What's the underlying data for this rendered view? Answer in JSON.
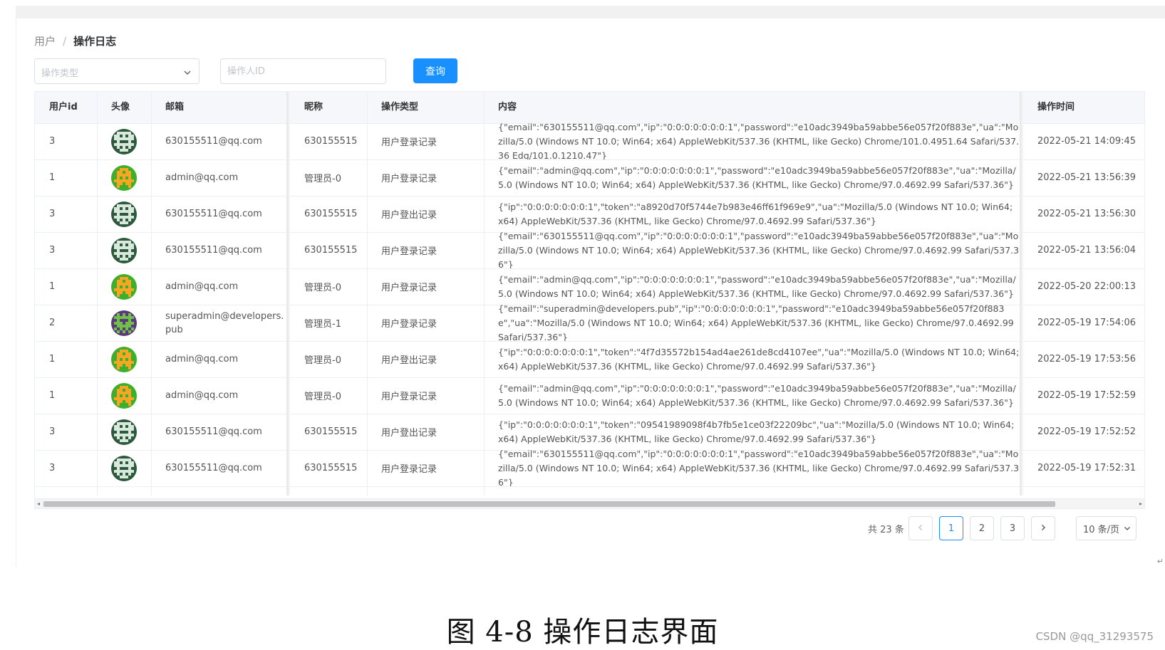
{
  "breadcrumb": {
    "parent": "用户",
    "separator": "/",
    "current": "操作日志"
  },
  "filters": {
    "type_placeholder": "操作类型",
    "operator_placeholder": "操作人ID",
    "query_label": "查询"
  },
  "table": {
    "headers": {
      "user_id": "用户id",
      "avatar": "头像",
      "email": "邮箱",
      "nickname": "昵称",
      "op_type": "操作类型",
      "content": "内容",
      "time": "操作时间"
    },
    "rows": [
      {
        "user_id": "3",
        "avatar": "dark-green-avatar",
        "email": "630155511@qq.com",
        "nickname": "630155515",
        "op_type": "用户登录记录",
        "content": "{\"email\":\"630155511@qq.com\",\"ip\":\"0:0:0:0:0:0:0:1\",\"password\":\"e10adc3949ba59abbe56e057f20f883e\",\"ua\":\"Mozilla/5.0 (Windows NT 10.0; Win64; x64) AppleWebKit/537.36 (KHTML, like Gecko) Chrome/101.0.4951.64 Safari/537.36 Edg/101.0.1210.47\"}",
        "time": "2022-05-21 14:09:45"
      },
      {
        "user_id": "1",
        "avatar": "green-orange-avatar",
        "email": "admin@qq.com",
        "nickname": "管理员-0",
        "op_type": "用户登录记录",
        "content": "{\"email\":\"admin@qq.com\",\"ip\":\"0:0:0:0:0:0:0:1\",\"password\":\"e10adc3949ba59abbe56e057f20f883e\",\"ua\":\"Mozilla/5.0 (Windows NT 10.0; Win64; x64) AppleWebKit/537.36 (KHTML, like Gecko) Chrome/97.0.4692.99 Safari/537.36\"}",
        "time": "2022-05-21 13:56:39"
      },
      {
        "user_id": "3",
        "avatar": "dark-green-avatar",
        "email": "630155511@qq.com",
        "nickname": "630155515",
        "op_type": "用户登出记录",
        "content": "{\"ip\":\"0:0:0:0:0:0:0:1\",\"token\":\"a8920d70f5744e7b983e46ff61f969e9\",\"ua\":\"Mozilla/5.0 (Windows NT 10.0; Win64; x64) AppleWebKit/537.36 (KHTML, like Gecko) Chrome/97.0.4692.99 Safari/537.36\"}",
        "time": "2022-05-21 13:56:30"
      },
      {
        "user_id": "3",
        "avatar": "dark-green-avatar",
        "email": "630155511@qq.com",
        "nickname": "630155515",
        "op_type": "用户登录记录",
        "content": "{\"email\":\"630155511@qq.com\",\"ip\":\"0:0:0:0:0:0:0:1\",\"password\":\"e10adc3949ba59abbe56e057f20f883e\",\"ua\":\"Mozilla/5.0 (Windows NT 10.0; Win64; x64) AppleWebKit/537.36 (KHTML, like Gecko) Chrome/97.0.4692.99 Safari/537.36\"}",
        "time": "2022-05-21 13:56:04"
      },
      {
        "user_id": "1",
        "avatar": "green-orange-avatar",
        "email": "admin@qq.com",
        "nickname": "管理员-0",
        "op_type": "用户登录记录",
        "content": "{\"email\":\"admin@qq.com\",\"ip\":\"0:0:0:0:0:0:0:1\",\"password\":\"e10adc3949ba59abbe56e057f20f883e\",\"ua\":\"Mozilla/5.0 (Windows NT 10.0; Win64; x64) AppleWebKit/537.36 (KHTML, like Gecko) Chrome/97.0.4692.99 Safari/537.36\"}",
        "time": "2022-05-20 22:00:13"
      },
      {
        "user_id": "2",
        "avatar": "purple-green-avatar",
        "email": "superadmin@developers.pub",
        "nickname": "管理员-1",
        "op_type": "用户登录记录",
        "content": "{\"email\":\"superadmin@developers.pub\",\"ip\":\"0:0:0:0:0:0:0:1\",\"password\":\"e10adc3949ba59abbe56e057f20f883e\",\"ua\":\"Mozilla/5.0 (Windows NT 10.0; Win64; x64) AppleWebKit/537.36 (KHTML, like Gecko) Chrome/97.0.4692.99 Safari/537.36\"}",
        "time": "2022-05-19 17:54:06"
      },
      {
        "user_id": "1",
        "avatar": "green-orange-avatar",
        "email": "admin@qq.com",
        "nickname": "管理员-0",
        "op_type": "用户登出记录",
        "content": "{\"ip\":\"0:0:0:0:0:0:0:1\",\"token\":\"4f7d35572b154ad4ae261de8cd4107ee\",\"ua\":\"Mozilla/5.0 (Windows NT 10.0; Win64; x64) AppleWebKit/537.36 (KHTML, like Gecko) Chrome/97.0.4692.99 Safari/537.36\"}",
        "time": "2022-05-19 17:53:56"
      },
      {
        "user_id": "1",
        "avatar": "green-orange-avatar",
        "email": "admin@qq.com",
        "nickname": "管理员-0",
        "op_type": "用户登录记录",
        "content": "{\"email\":\"admin@qq.com\",\"ip\":\"0:0:0:0:0:0:0:1\",\"password\":\"e10adc3949ba59abbe56e057f20f883e\",\"ua\":\"Mozilla/5.0 (Windows NT 10.0; Win64; x64) AppleWebKit/537.36 (KHTML, like Gecko) Chrome/97.0.4692.99 Safari/537.36\"}",
        "time": "2022-05-19 17:52:59"
      },
      {
        "user_id": "3",
        "avatar": "dark-green-avatar",
        "email": "630155511@qq.com",
        "nickname": "630155515",
        "op_type": "用户登出记录",
        "content": "{\"ip\":\"0:0:0:0:0:0:0:1\",\"token\":\"09541989098f4b7fb5e1ce03f22209bc\",\"ua\":\"Mozilla/5.0 (Windows NT 10.0; Win64; x64) AppleWebKit/537.36 (KHTML, like Gecko) Chrome/97.0.4692.99 Safari/537.36\"}",
        "time": "2022-05-19 17:52:52"
      },
      {
        "user_id": "3",
        "avatar": "dark-green-avatar",
        "email": "630155511@qq.com",
        "nickname": "630155515",
        "op_type": "用户登录记录",
        "content": "{\"email\":\"630155511@qq.com\",\"ip\":\"0:0:0:0:0:0:0:1\",\"password\":\"e10adc3949ba59abbe56e057f20f883e\",\"ua\":\"Mozilla/5.0 (Windows NT 10.0; Win64; x64) AppleWebKit/537.36 (KHTML, like Gecko) Chrome/97.0.4692.99 Safari/537.36\"}",
        "time": "2022-05-19 17:52:31"
      }
    ]
  },
  "pagination": {
    "total": "共 23 条",
    "prev_icon": "chevron-left-icon",
    "pages": [
      "1",
      "2",
      "3"
    ],
    "active_page": "1",
    "next_icon": "chevron-right-icon",
    "page_size": "10 条/页"
  },
  "avatars": {
    "dark-green-avatar": {
      "bg": "#2d5a3d",
      "fg": "#d9e8dc"
    },
    "green-orange-avatar": {
      "bg": "#3fae2a",
      "fg": "#f5a623"
    },
    "purple-green-avatar": {
      "bg": "#5b3a7a",
      "fg": "#6fbf4a"
    }
  },
  "colors": {
    "accent": "#1890ff"
  },
  "caption": "图 4-8 操作日志界面",
  "watermark": "CSDN @qq_31293575"
}
